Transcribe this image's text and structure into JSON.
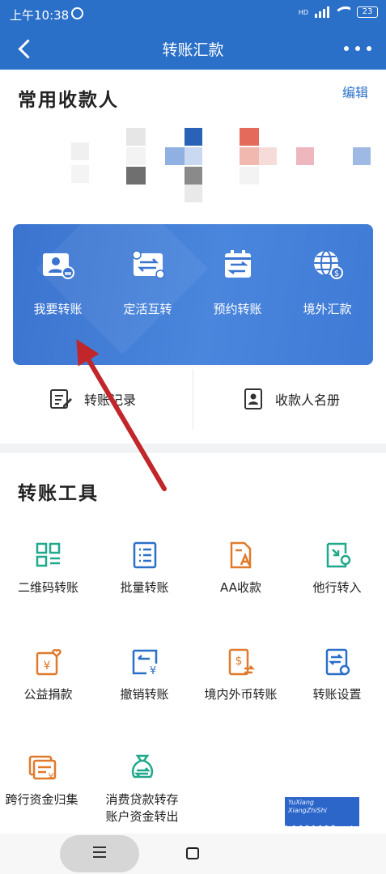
{
  "status_bar": {
    "time": "上午10:38",
    "network": "HD",
    "battery": "23"
  },
  "header": {
    "title": "转账汇款"
  },
  "payees": {
    "title": "常用收款人",
    "edit_label": "编辑"
  },
  "quick_actions": [
    {
      "label": "我要转账",
      "icon": "payee-card-icon"
    },
    {
      "label": "定活互转",
      "icon": "exchange-card-icon"
    },
    {
      "label": "预约转账",
      "icon": "calendar-transfer-icon"
    },
    {
      "label": "境外汇款",
      "icon": "globe-dollar-icon"
    }
  ],
  "links": {
    "records": "转账记录",
    "payee_book": "收款人名册"
  },
  "tools": {
    "title": "转账工具",
    "items": [
      {
        "label": "二维码转账",
        "icon": "qr-code-icon",
        "color": "#1fa88a"
      },
      {
        "label": "批量转账",
        "icon": "list-icon",
        "color": "#2a6fc8"
      },
      {
        "label": "AA收款",
        "icon": "aa-doc-icon",
        "color": "#e07a2c"
      },
      {
        "label": "他行转入",
        "icon": "transfer-in-icon",
        "color": "#1fa88a"
      },
      {
        "label": "公益捐款",
        "icon": "heart-donate-icon",
        "color": "#e07a2c"
      },
      {
        "label": "撤销转账",
        "icon": "undo-yen-icon",
        "color": "#2a6fc8"
      },
      {
        "label": "境内外币转账",
        "icon": "dollar-exchange-icon",
        "color": "#e07a2c"
      },
      {
        "label": "转账设置",
        "icon": "settings-doc-icon",
        "color": "#2a6fc8"
      },
      {
        "label": "跨行资金归集",
        "icon": "fund-collect-icon",
        "color": "#e07a2c"
      },
      {
        "label": "消费贷款转存\n账户资金转出",
        "line1": "消费贷款转存",
        "line2": "账户资金转出",
        "icon": "loan-bag-icon",
        "color": "#1fa88a"
      }
    ]
  },
  "watermark": {
    "pinyin1": "YuXiang",
    "pinyin2": "XiangZhiShi",
    "text": "誉祥祥知识"
  },
  "colors": {
    "primary": "#2a6fc8",
    "green": "#1fa88a",
    "orange": "#e07a2c",
    "annotation_arrow": "#c0262a"
  }
}
